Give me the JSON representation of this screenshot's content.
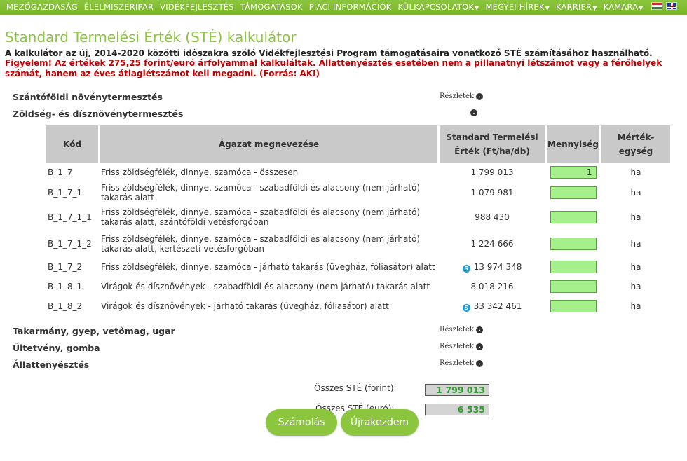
{
  "nav": {
    "items": [
      {
        "label": "MEZŐGAZDASÁG",
        "dropdown": false
      },
      {
        "label": "ÉLELMISZERIPAR",
        "dropdown": false
      },
      {
        "label": "VIDÉKFEJLESZTÉS",
        "dropdown": false
      },
      {
        "label": "TÁMOGATÁSOK",
        "dropdown": false
      },
      {
        "label": "PIACI INFORMÁCIÓK",
        "dropdown": false
      },
      {
        "label": "KÜLKAPCSOLATOK",
        "dropdown": true
      },
      {
        "label": "MEGYEI HÍREK",
        "dropdown": true
      },
      {
        "label": "KARRIER",
        "dropdown": true
      },
      {
        "label": "KAMARA",
        "dropdown": true
      }
    ],
    "flags": [
      "hungarian-flag-icon",
      "uk-flag-icon"
    ]
  },
  "page": {
    "title": "Standard Termelési Érték (STÉ) kalkulátor",
    "intro": "A kalkulátor az új, 2014-2020 közötti időszakra szóló Vidékfejlesztési Program támogatásaira vonatkozó STÉ számításához használható.",
    "warning": "Figyelem! Az értékek 275,25 forint/euró árfolyammal kalkuláltak. Állattenyésztés esetében nem a pillanatnyi létszámot vagy a férőhelyek számát, hanem az éves átlaglétszámot kell megadni. (Forrás: AKI)"
  },
  "sections": {
    "szanto": {
      "label": "Szántóföldi növénytermesztés",
      "details": "Részletek"
    },
    "zoldseg": {
      "label": "Zöldség- és dísznövénytermesztés"
    },
    "takarmany": {
      "label": "Takarmány, gyep, vetőmag, ugar",
      "details": "Részletek"
    },
    "ultetveny": {
      "label": "Ültetvény, gomba",
      "details": "Részletek"
    },
    "allat": {
      "label": "Állattenyésztés",
      "details": "Részletek"
    }
  },
  "table": {
    "headers": {
      "code": "Kód",
      "name": "Ágazat megnevezése",
      "ste_line1": "Standard Termelési",
      "ste_line2": "Érték (Ft/ha/db)",
      "qty": "Mennyiség",
      "unit": "Mérték-egység"
    },
    "rows": [
      {
        "code": "B_1_7",
        "name": "Friss zöldségfélék, dinnye, szamóca - összesen",
        "value": "1 799 013",
        "skype": false,
        "qty": "1",
        "unit": "ha"
      },
      {
        "code": "B_1_7_1",
        "name": "Friss zöldségfélék, dinnye, szamóca - szabadföldi és alacsony (nem járható) takarás alatt",
        "value": "1 079 981",
        "skype": false,
        "qty": "",
        "unit": "ha"
      },
      {
        "code": "B_1_7_1_1",
        "name": "Friss zöldségfélék, dinnye, szamóca - szabadföldi és alacsony (nem járható) takarás alatt, szántóföldi vetésforgóban",
        "value": "988 430",
        "skype": false,
        "qty": "",
        "unit": "ha"
      },
      {
        "code": "B_1_7_1_2",
        "name": "Friss zöldségfélék, dinnye, szamóca - szabadföldi és alacsony (nem járható) takarás alatt, kertészeti vetésforgóban",
        "value": "1 224 666",
        "skype": false,
        "qty": "",
        "unit": "ha"
      },
      {
        "code": "B_1_7_2",
        "name": "Friss zöldségfélék, dinnye, szamóca - járható takarás (üvegház, fóliasátor) alatt",
        "value": "13 974 348",
        "skype": true,
        "qty": "",
        "unit": "ha"
      },
      {
        "code": "B_1_8_1",
        "name": "Virágok és dísznövények - szabadföldi és alacsony (nem járható) takarás alatt",
        "value": "8 018 216",
        "skype": false,
        "qty": "",
        "unit": "ha"
      },
      {
        "code": "B_1_8_2",
        "name": "Virágok és dísznövények - járható takarás (üvegház, fóliasátor) alatt",
        "value": "33 342 461",
        "skype": true,
        "qty": "",
        "unit": "ha"
      }
    ]
  },
  "totals": {
    "forint_label": "Összes STÉ (forint):",
    "forint_value": "1 799 013",
    "euro_label": "Összes STÉ (euró):",
    "euro_value": "6 535"
  },
  "buttons": {
    "calculate": "Számolás",
    "restart": "Újrakezdem"
  },
  "colors": {
    "nav_green": "#8cc63f",
    "title_green": "#8cc63f",
    "warning_red": "#c00000",
    "input_green": "#a6f08c",
    "skype_blue": "#1a9bd7",
    "total_green": "#2e9e2e"
  }
}
